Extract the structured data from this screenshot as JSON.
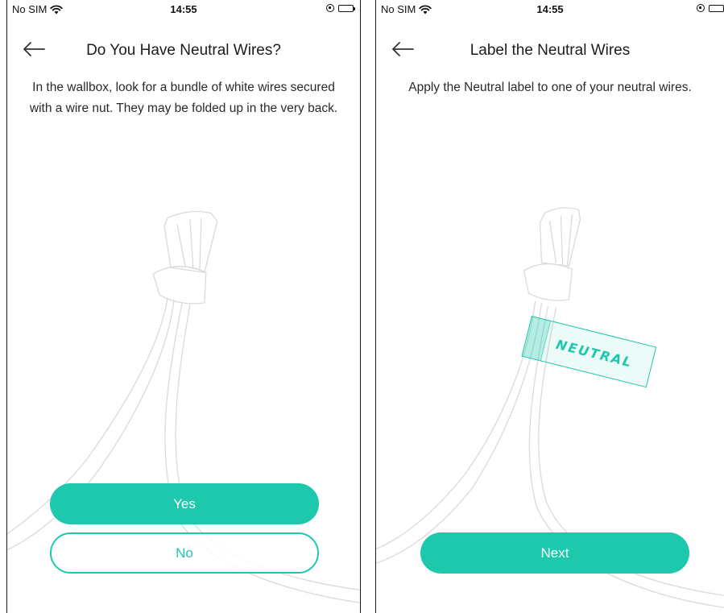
{
  "colors": {
    "accent": "#1dc8ac",
    "wire_outline": "#d9d9d9",
    "text": "#2a2a2a"
  },
  "screens": [
    {
      "status": {
        "carrier": "No SIM",
        "time": "14:55"
      },
      "title": "Do You Have Neutral Wires?",
      "instructions": "In the wallbox, look for a bundle of white wires secured with a wire nut. They may be folded up in the very back.",
      "buttons": {
        "yes": "Yes",
        "no": "No"
      },
      "icons": [
        "wifi-icon",
        "back-arrow-icon",
        "orientation-lock-icon",
        "battery-icon"
      ]
    },
    {
      "status": {
        "carrier": "No SIM",
        "time": "14:55"
      },
      "title": "Label the Neutral Wires",
      "instructions": "Apply the Neutral label to one of your neutral wires.",
      "label_text": "NEUTRAL",
      "buttons": {
        "next": "Next"
      },
      "icons": [
        "wifi-icon",
        "back-arrow-icon",
        "orientation-lock-icon",
        "battery-icon"
      ]
    }
  ]
}
